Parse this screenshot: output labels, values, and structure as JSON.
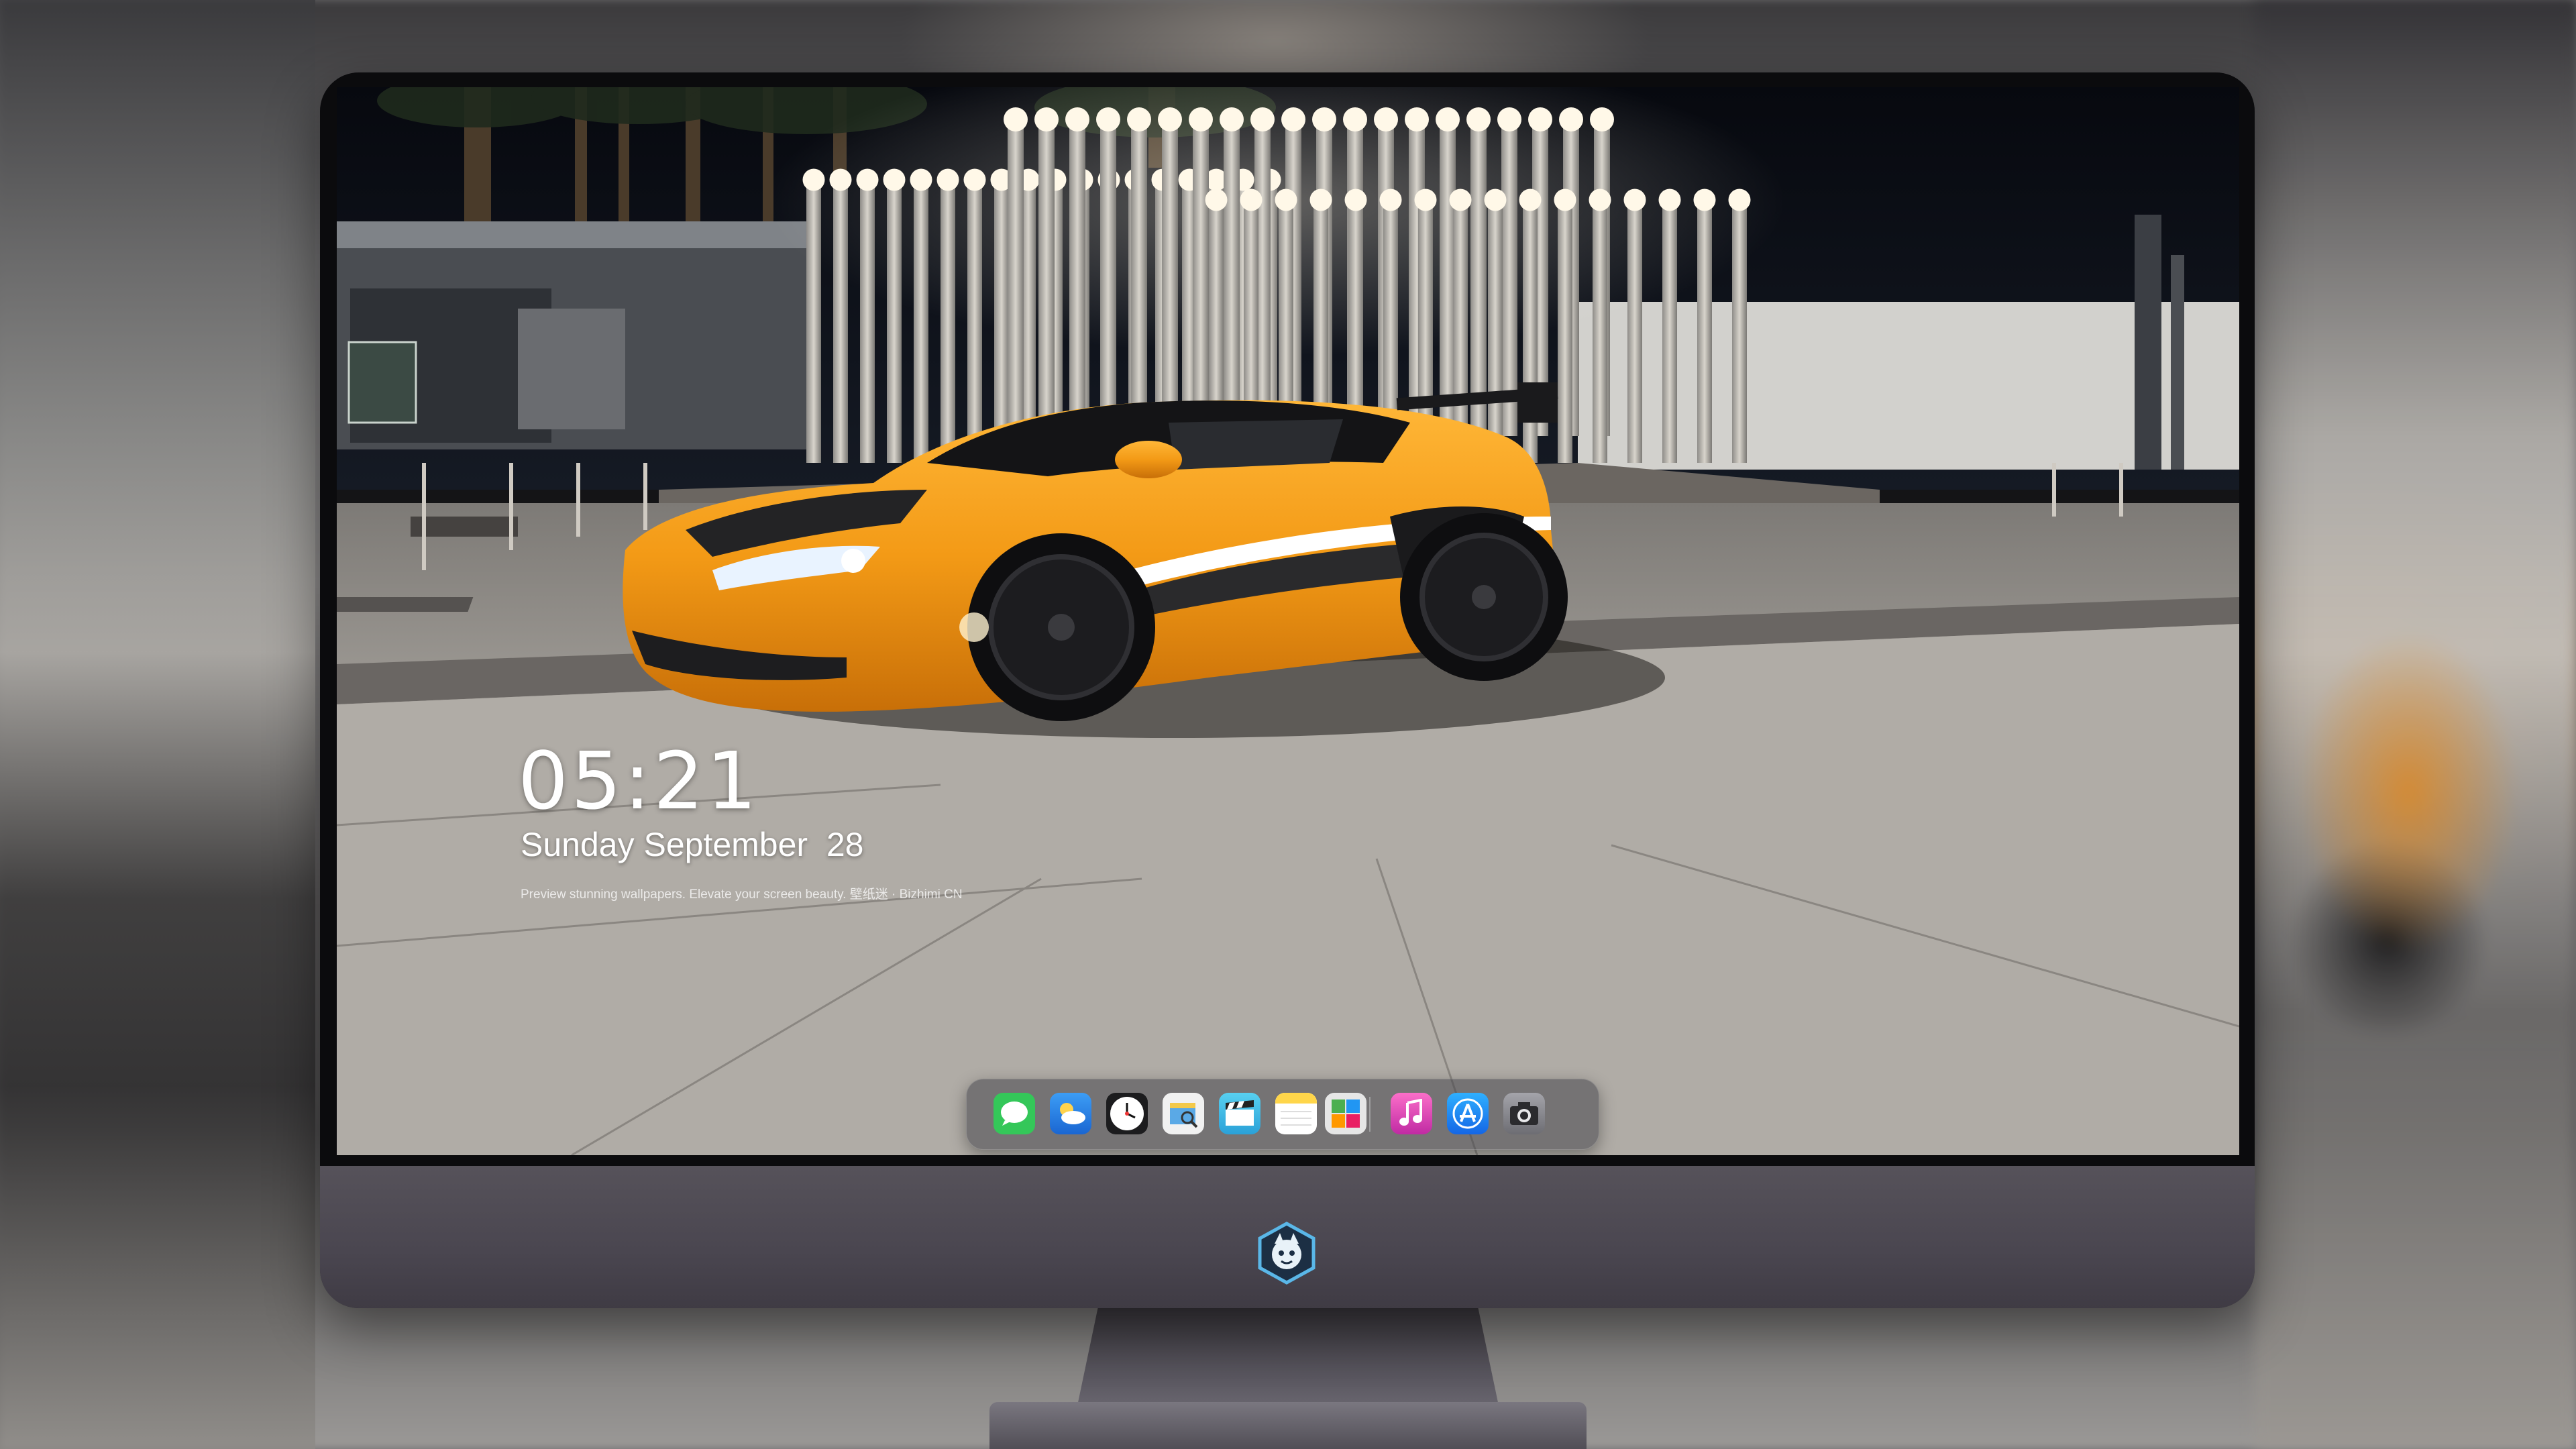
{
  "lock_screen": {
    "time": "05:21",
    "date": "Sunday September  28",
    "tagline": "Preview stunning wallpapers. Elevate your screen beauty. 壁纸迷 · Bizhimi CN"
  },
  "dock": {
    "apps": [
      {
        "name": "messages-icon",
        "color": "#34c759"
      },
      {
        "name": "weather-icon",
        "color": "#2f8cf0"
      },
      {
        "name": "clock-icon",
        "color": "#1c1c1e"
      },
      {
        "name": "preview-icon",
        "color": "#f1f1f1"
      },
      {
        "name": "final-cut-icon",
        "color": "#45c1e8"
      },
      {
        "name": "notes-icon",
        "color": "#ffd64a"
      },
      {
        "name": "photo-booth-icon",
        "color": "#e6e6e6"
      },
      {
        "name": "music-icon",
        "color": "#f14ab5"
      },
      {
        "name": "app-store-icon",
        "color": "#1e8cff"
      },
      {
        "name": "camera-icon",
        "color": "#8d8d92"
      }
    ]
  },
  "colors": {
    "car_orange": "#f39a16",
    "sky": "#0a0d14",
    "ground": "#a39f99"
  }
}
